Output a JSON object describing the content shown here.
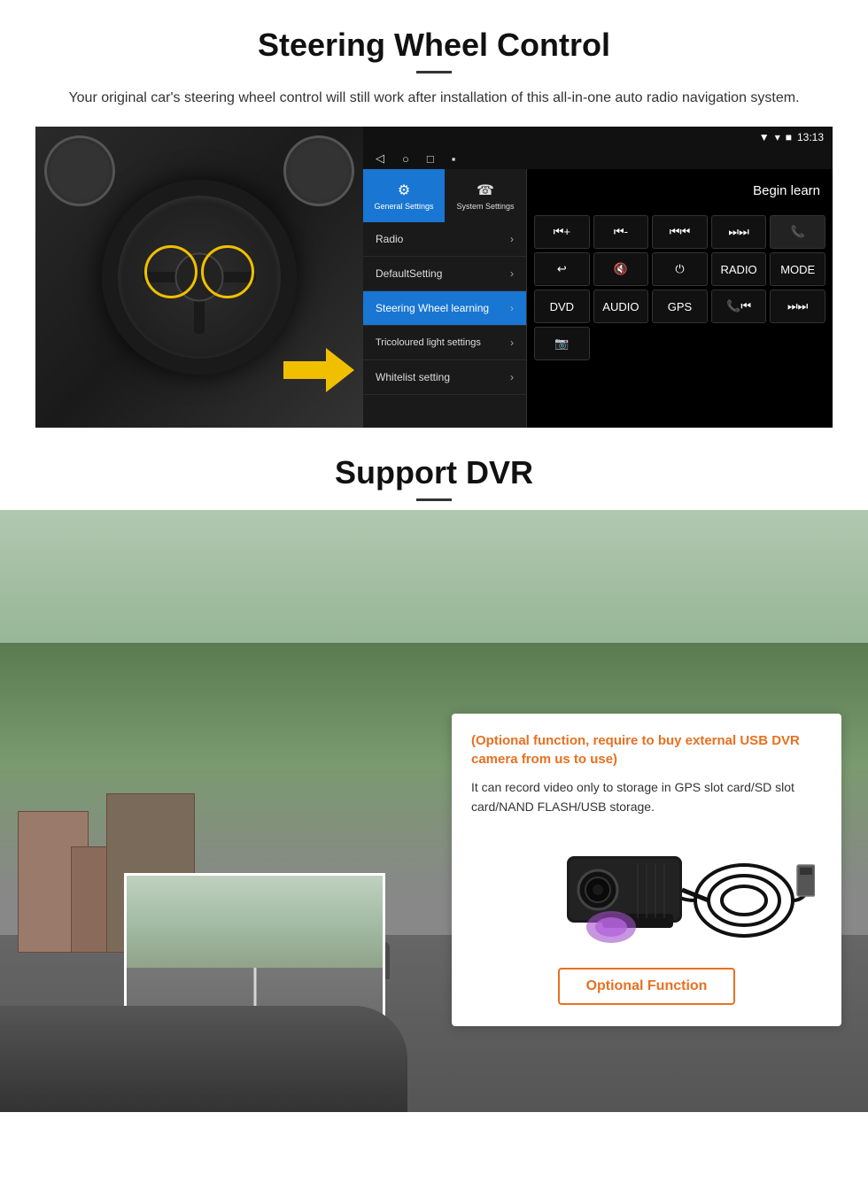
{
  "section1": {
    "title": "Steering Wheel Control",
    "subtitle": "Your original car's steering wheel control will still work after installation of this all-in-one auto radio navigation system.",
    "ui": {
      "statusbar": {
        "time": "13:13",
        "signal": "▼",
        "wifi": "▾",
        "battery": "■"
      },
      "tabs": [
        {
          "label": "General Settings",
          "active": true,
          "icon": "⚙"
        },
        {
          "label": "System Settings",
          "active": false,
          "icon": "☎"
        }
      ],
      "nav_items": [
        {
          "label": "Radio",
          "active": false
        },
        {
          "label": "DefaultSetting",
          "active": false
        },
        {
          "label": "Steering Wheel learning",
          "active": true
        },
        {
          "label": "Tricoloured light settings",
          "active": false
        },
        {
          "label": "Whitelist setting",
          "active": false
        }
      ],
      "begin_learn": "Begin learn",
      "control_buttons": [
        "⏮+",
        "⏮-",
        "⏮⏮",
        "⏭⏭",
        "📞",
        "↩",
        "🔇",
        "⏻",
        "RADIO",
        "MODE",
        "DVD",
        "AUDIO",
        "GPS",
        "📞⏮",
        "⏭⏭"
      ]
    }
  },
  "section2": {
    "title": "Support DVR",
    "title_divider": true,
    "info_box": {
      "optional_title": "(Optional function, require to buy external USB DVR camera from us to use)",
      "description": "It can record video only to storage in GPS slot card/SD slot card/NAND FLASH/USB storage."
    },
    "optional_fn_button": "Optional Function"
  }
}
